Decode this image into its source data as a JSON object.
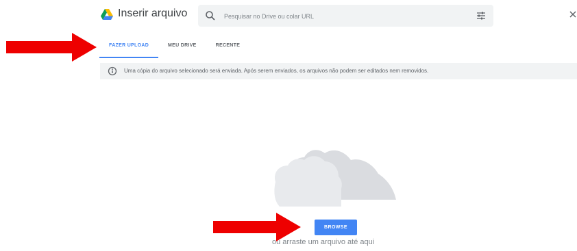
{
  "dialog": {
    "title": "Inserir arquivo",
    "search_placeholder": "Pesquisar no Drive ou colar URL"
  },
  "tabs": [
    {
      "label": "Fazer upload",
      "active": true
    },
    {
      "label": "Meu Drive",
      "active": false
    },
    {
      "label": "Recente",
      "active": false
    }
  ],
  "info_banner": {
    "text": "Uma cópia do arquivo selecionado será enviada. Após serem enviados, os arquivos não podem ser editados nem removidos."
  },
  "upload": {
    "browse_label": "Browse",
    "drag_hint": "ou arraste um arquivo até aqui"
  },
  "icons": {
    "logo": "google-drive-icon",
    "search": "search-icon",
    "filter": "filter-options-icon",
    "close": "close-icon",
    "info": "info-icon",
    "cloud": "cloud-illustration",
    "annotations": "red-arrow-icon"
  },
  "colors": {
    "accent": "#4285f4",
    "annotation_arrow": "#ee0000",
    "banner_bg": "#f1f3f4",
    "text": "#3c4043"
  }
}
